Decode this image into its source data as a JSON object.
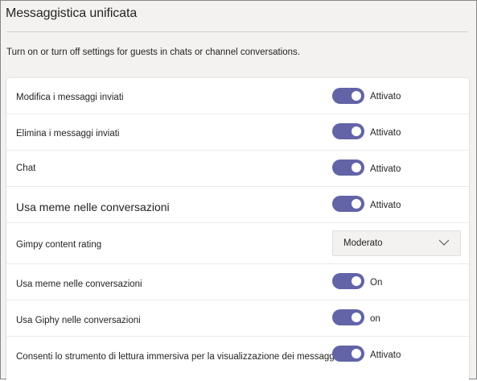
{
  "header": {
    "title": "Messaggistica unificata",
    "description": "Turn on or turn off settings for guests in chats or channel conversations."
  },
  "colors": {
    "toggle_on": "#6264a7",
    "background": "#f3f2f1",
    "card": "#ffffff"
  },
  "settings": [
    {
      "label": "Modifica i messaggi inviati",
      "control": "toggle",
      "state": "Attivato",
      "on": true
    },
    {
      "label": "Elimina i messaggi inviati",
      "control": "toggle",
      "state": "Attivato",
      "on": true
    },
    {
      "label": "Chat",
      "control": "toggle",
      "state": "Attivato",
      "on": true
    },
    {
      "label": "Usa meme nelle conversazioni",
      "control": "toggle",
      "state": "Attivato",
      "on": true
    },
    {
      "label": "Gimpy content rating",
      "control": "dropdown",
      "value": "Moderato",
      "icon": "chevron-down-icon"
    },
    {
      "label": "Usa meme nelle conversazioni",
      "control": "toggle",
      "state": "On",
      "on": true
    },
    {
      "label": "Usa Giphy nelle conversazioni",
      "control": "toggle",
      "state": "on",
      "on": true
    },
    {
      "label": "Consenti lo strumento di lettura immersiva per la visualizzazione dei messaggi",
      "control": "toggle",
      "state": "Attivato",
      "on": true
    }
  ]
}
